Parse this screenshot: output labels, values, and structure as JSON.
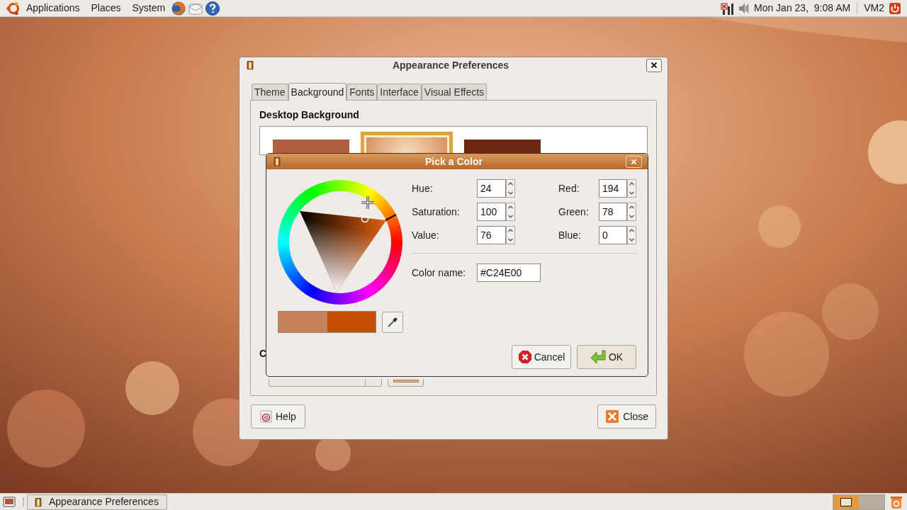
{
  "top_panel": {
    "menus": [
      "Applications",
      "Places",
      "System"
    ],
    "clock": "Mon Jan 23,  9:08 AM",
    "user": "VM2"
  },
  "window": {
    "title": "Appearance Preferences",
    "tabs": [
      {
        "label": "Theme",
        "selected": false
      },
      {
        "label": "Background",
        "selected": true
      },
      {
        "label": "Fonts",
        "selected": false
      },
      {
        "label": "Interface",
        "selected": false
      },
      {
        "label": "Visual Effects",
        "selected": false
      }
    ],
    "section_title": "Desktop Background",
    "thumbnails": [
      {
        "selected": false,
        "color": "#b0603e"
      },
      {
        "selected": true,
        "color": "#d89060"
      },
      {
        "selected": false,
        "color": "#6a2810"
      }
    ],
    "cut_heading": "C",
    "help_button": "Help",
    "close_button": "Close"
  },
  "dialog": {
    "title": "Pick a Color",
    "hsv_fields": [
      {
        "label": "Hue:",
        "value": "24"
      },
      {
        "label": "Saturation:",
        "value": "100"
      },
      {
        "label": "Value:",
        "value": "76"
      }
    ],
    "rgb_fields": [
      {
        "label": "Red:",
        "value": "194"
      },
      {
        "label": "Green:",
        "value": "78"
      },
      {
        "label": "Blue:",
        "value": "0"
      }
    ],
    "color_name": {
      "label": "Color name:",
      "value": "#C24E00"
    },
    "swatches": [
      {
        "color": "#c8825a"
      },
      {
        "color": "#c24e00"
      }
    ],
    "cancel_button": "Cancel",
    "ok_button": "OK"
  },
  "taskbar": {
    "tasks": [
      {
        "label": "Appearance Preferences"
      }
    ],
    "workspaces": [
      {
        "selected": true
      },
      {
        "selected": false
      }
    ]
  }
}
